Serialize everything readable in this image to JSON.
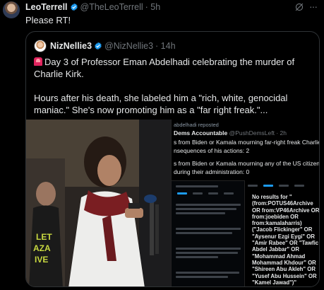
{
  "tweet": {
    "author_name": "LeoTerrell",
    "author_handle": "@TheLeoTerrell",
    "time": "· 5h",
    "text": "Please RT!"
  },
  "icons": {
    "verified": "verified-badge-icon",
    "grok": "grok-icon",
    "more": "more-icon"
  },
  "colors": {
    "verified": "#1d9bf0",
    "muted": "#71767b",
    "border": "#2f3336",
    "siren": "#e0245e"
  },
  "quote": {
    "author_name": "NizNellie3",
    "author_handle": "@NizNellie3",
    "time": "· 14h",
    "line1": "Day 3 of Professor Eman Abdelhadi celebrating the murder of Charlie Kirk.",
    "line2": "Hours after his death, she labeled him a \"rich, white, genocidal maniac.\" She's now promoting him as a \"far right freak.\"..."
  },
  "media": {
    "screenshot_top": {
      "reposted": "abdelhadi reposted",
      "account_name": "Dems Accountable",
      "account_handle": "@PushDemsLeft · 2h",
      "line1": "s from Biden or Kamala mourning far-right freak Charlie Ki",
      "line2": "nsequences of his actions: 2",
      "line3": "s from Biden or Kamala mourning any of the US citizens m",
      "line4": "during their administration: 0"
    },
    "screenshot_right": {
      "text": "No results for \"(from:POTUS46Archive OR from:VP46Archive OR from:joebiden OR from:kamalaharris) (\"Jacob Flickinger\" OR \"Aysenur Ezgi Eygi\" OR \"Amir Rabee\" OR \"Tawfic Abdel Jabbar\" OR \"Mohammad Ahmad Mohammad Khdour\" OR \"Shireen Abu Akleh\" OR \"Yusef Abu Hussein\" OR \"Kamel Jawad\")\""
    }
  }
}
